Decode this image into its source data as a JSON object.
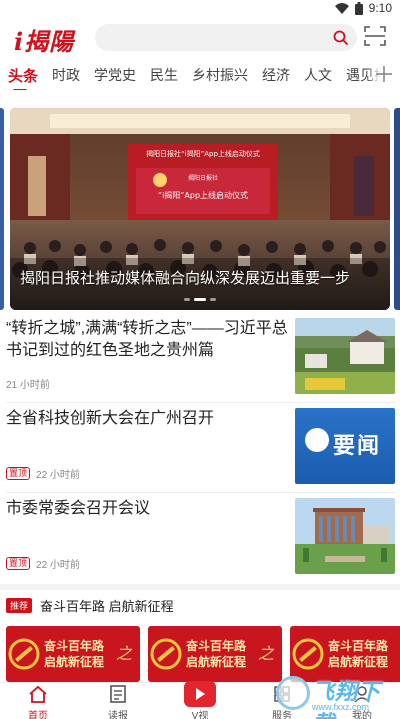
{
  "status_bar": {
    "time": "9:10"
  },
  "header": {
    "logo_text": "揭陽",
    "search_placeholder": ""
  },
  "tabs": [
    {
      "label": "头条",
      "active": true
    },
    {
      "label": "时政"
    },
    {
      "label": "学党史"
    },
    {
      "label": "民生"
    },
    {
      "label": "乡村振兴"
    },
    {
      "label": "经济"
    },
    {
      "label": "人文"
    },
    {
      "label": "遇见揭"
    }
  ],
  "banner": {
    "caption": "揭阳日报社推动媒体融合向纵深发展迈出重要一步",
    "stage_title": "揭阳日报社“i揭阳”App上线启动仪式",
    "screen_title": "“i揭阳”App上线启动仪式",
    "screen_brand": "揭阳日报社",
    "slide_count": 3,
    "active_slide": 1
  },
  "news": [
    {
      "title": "“转折之城”,满满“转折之志”——习近平总书记到过的红色圣地之贵州篇",
      "tag": "",
      "time": "21 小时前"
    },
    {
      "title": "全省科技创新大会在广州召开",
      "tag": "置顶",
      "time": "22 小时前",
      "thumb_text": "要闻"
    },
    {
      "title": "市委常委会召开会议",
      "tag": "置顶",
      "time": "22 小时前"
    }
  ],
  "section": {
    "tag": "推荐",
    "title": "奋斗百年路 启航新征程",
    "card_text": [
      "奋斗百年路",
      "启航新征程"
    ],
    "card_zhi": "之"
  },
  "bottom_nav": [
    {
      "label": "首页",
      "active": true
    },
    {
      "label": "读报"
    },
    {
      "label": "V视"
    },
    {
      "label": "服务"
    },
    {
      "label": "我的"
    }
  ],
  "watermark": {
    "text": "飞翔下载",
    "url": "www.fxxz.com"
  },
  "colors": {
    "accent": "#d0101b",
    "yaowen_blue": "#1f64b8"
  }
}
